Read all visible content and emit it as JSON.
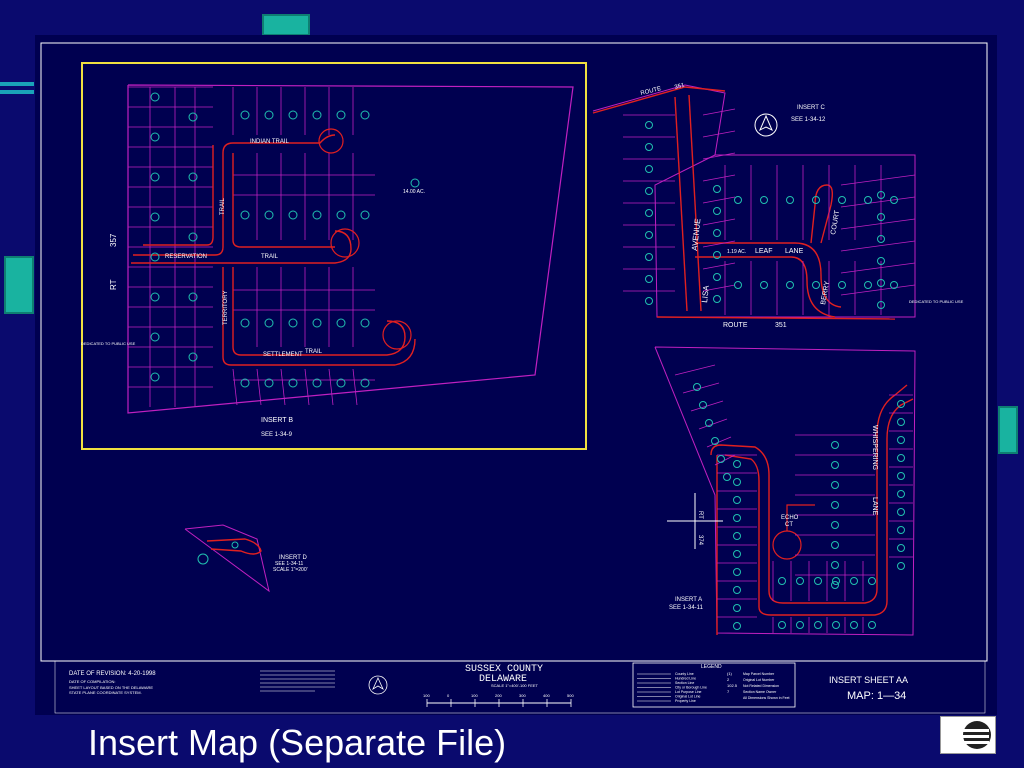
{
  "slide": {
    "title": "Insert Map (Separate File)"
  },
  "insert_b": {
    "roads": [
      "INDIAN TRAIL",
      "RESERVATION",
      "TRAIL",
      "SETTLEMENT",
      "TRAIL",
      "TRAIL",
      "TERRITORY",
      "RT",
      "357"
    ],
    "area_label": "14.00 AC.",
    "dedication": "DEDICATED TO PUBLIC USE",
    "title": "INSERT B",
    "see": "SEE 1-34-9"
  },
  "insert_c": {
    "roads": [
      "ROUTE",
      "351",
      "LISA",
      "AVENUE",
      "LEAF",
      "LANE",
      "COURT",
      "BERRY",
      "ROUTE",
      "351"
    ],
    "area_label": "1.19 AC.",
    "dedication": "DEDICATED TO PUBLIC USE",
    "title": "INSERT C",
    "see": "SEE 1-34-12"
  },
  "insert_a": {
    "roads": [
      "WHISPERING",
      "LANE",
      "ECHO",
      "CT",
      "RT",
      "374"
    ],
    "title": "INSERT A",
    "see": "SEE 1-34-11"
  },
  "insert_d": {
    "title": "INSERT D",
    "see": "SEE 1-34-11",
    "scale": "SCALE 1\"=200'"
  },
  "title_block": {
    "revision": "DATE OF REVISION: 4-20-1998",
    "compilation": "DATE OF COMPILATION:",
    "layout_note_1": "SHEET LAYOUT BASED ON THE DELAWARE",
    "layout_note_2": "STATE PLANE COORDINATE SYSTEM.",
    "county": "SUSSEX COUNTY",
    "state": "DELAWARE",
    "scale": "SCALE 1\"=400'-100 FEET",
    "scale_ticks": [
      "100",
      "0",
      "100",
      "200",
      "300",
      "400",
      "500"
    ],
    "legend_title": "LEGEND",
    "legend_items": [
      "County Line",
      "Hundred Line",
      "Section Line",
      "City or Borough Line",
      "Lot Purpose Line",
      "Original Lot Line",
      "Property Line"
    ],
    "legend_right": [
      "Map Parcel Number",
      "Original Lot Number",
      "Not Related Dimension",
      "Section Name Owner",
      "All Dimensions Shown in Feet"
    ],
    "legend_symbols": [
      "(1)",
      "2",
      "102.5",
      "7"
    ],
    "sheet": "INSERT SHEET   AA",
    "map": "MAP: 1—34"
  },
  "colors": {
    "background": "#0a0a6e",
    "map_background": "#000050",
    "lot_lines": "#c020c0",
    "road_lines": "#e02020",
    "insert_highlight": "#f0e040",
    "parcel_markers": "#20c0b0",
    "text": "#ffffff"
  },
  "icons": [
    "north-arrow-icon",
    "compass-cross-icon",
    "county-logo-icon"
  ]
}
